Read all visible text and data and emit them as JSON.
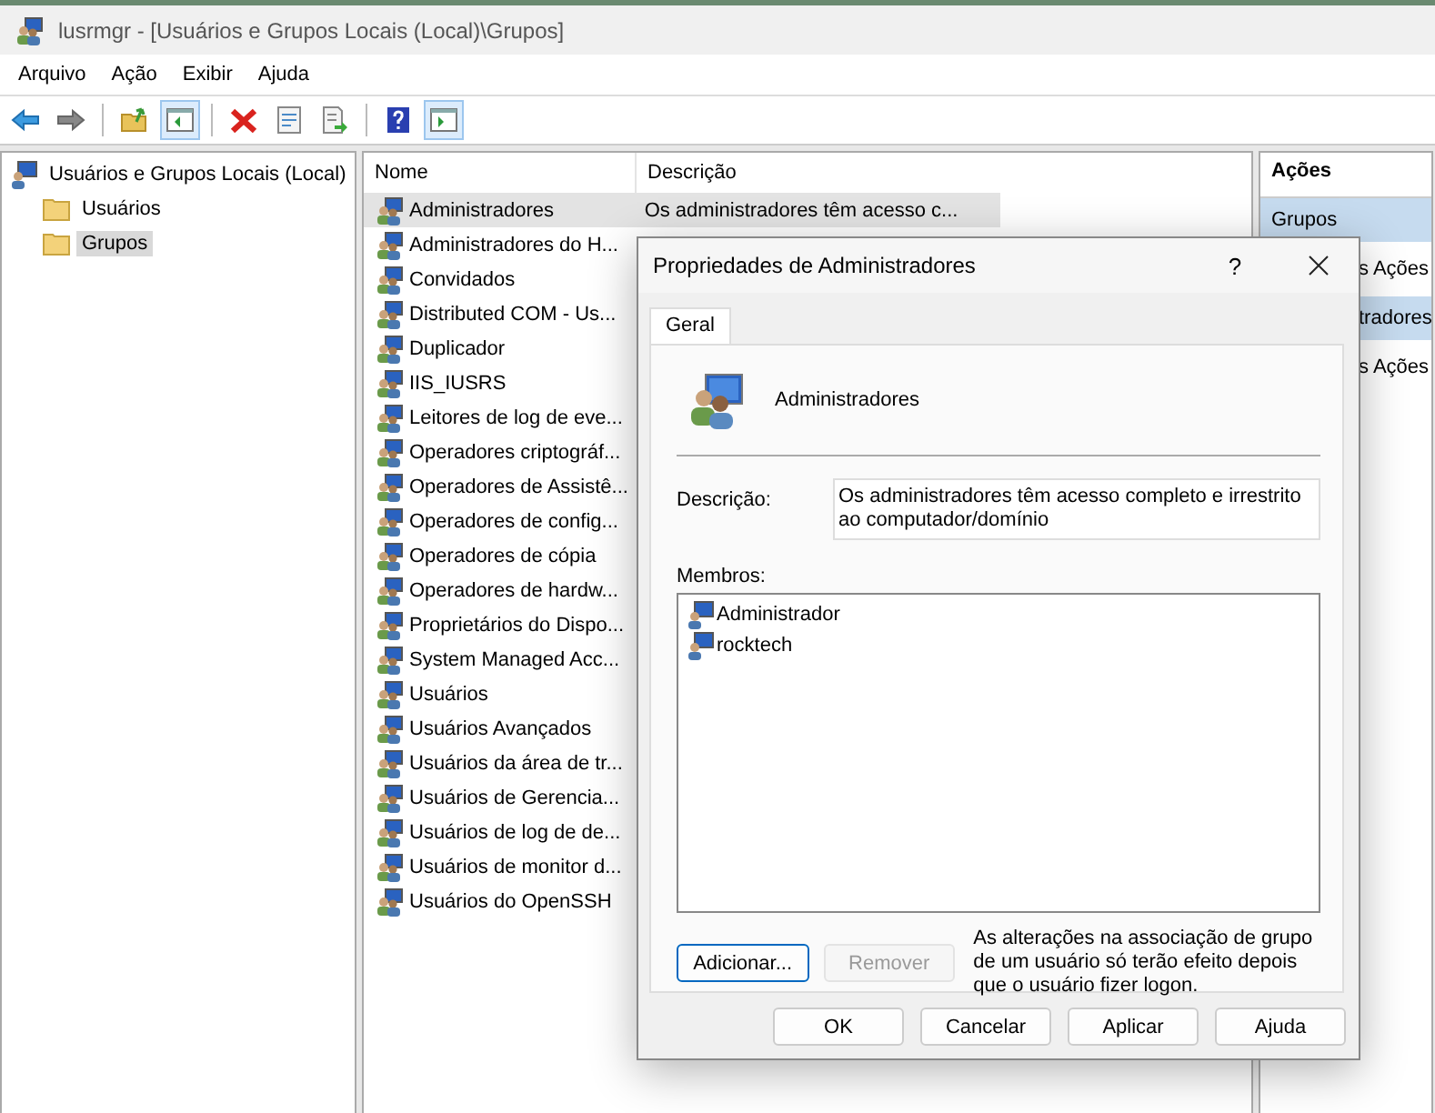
{
  "window": {
    "title": "lusrmgr - [Usuários e Grupos Locais (Local)\\Grupos]"
  },
  "menu": [
    "Arquivo",
    "Ação",
    "Exibir",
    "Ajuda"
  ],
  "toolbar": [
    [
      {
        "kind": "back",
        "on": false
      },
      {
        "kind": "forward",
        "on": false
      }
    ],
    [
      {
        "kind": "up",
        "on": false
      },
      {
        "kind": "tree",
        "on": true
      }
    ],
    [
      {
        "kind": "delete",
        "on": false
      },
      {
        "kind": "properties",
        "on": false
      },
      {
        "kind": "export",
        "on": false
      }
    ],
    [
      {
        "kind": "help",
        "on": false
      },
      {
        "kind": "pane",
        "on": true
      }
    ]
  ],
  "tree": {
    "label": "Usuários e Grupos Locais (Local)",
    "children": [
      {
        "label": "Usuários",
        "selected": false
      },
      {
        "label": "Grupos",
        "selected": true
      }
    ]
  },
  "list": {
    "columns": [
      "Nome",
      "Descrição"
    ],
    "rows": [
      {
        "name": "Administradores",
        "description": "Os administradores têm acesso c...",
        "selected": true
      },
      {
        "name": "Administradores do H...",
        "selected": false
      },
      {
        "name": "Convidados",
        "selected": false
      },
      {
        "name": "Distributed COM - Us...",
        "selected": false
      },
      {
        "name": "Duplicador",
        "selected": false
      },
      {
        "name": "IIS_IUSRS",
        "selected": false
      },
      {
        "name": "Leitores de log de eve...",
        "selected": false
      },
      {
        "name": "Operadores criptográf...",
        "selected": false
      },
      {
        "name": "Operadores de Assistê...",
        "selected": false
      },
      {
        "name": "Operadores de config...",
        "selected": false
      },
      {
        "name": "Operadores de cópia",
        "selected": false
      },
      {
        "name": "Operadores de hardw...",
        "selected": false
      },
      {
        "name": "Proprietários do Dispo...",
        "selected": false
      },
      {
        "name": "System Managed Acc...",
        "selected": false
      },
      {
        "name": "Usuários",
        "selected": false
      },
      {
        "name": "Usuários Avançados",
        "selected": false
      },
      {
        "name": "Usuários da área de tr...",
        "selected": false
      },
      {
        "name": "Usuários de Gerencia...",
        "selected": false
      },
      {
        "name": "Usuários de log de de...",
        "selected": false
      },
      {
        "name": "Usuários de monitor d...",
        "selected": false
      },
      {
        "name": "Usuários do OpenSSH",
        "selected": false
      }
    ]
  },
  "actions": {
    "title": "Ações",
    "items": [
      {
        "kind": "header",
        "label": "Grupos"
      },
      {
        "kind": "link",
        "label": "s Ações"
      },
      {
        "kind": "header",
        "label": "tradores"
      },
      {
        "kind": "link",
        "label": "s Ações"
      }
    ]
  },
  "dialog": {
    "title": "Propriedades de Administradores",
    "help": "?",
    "tabs": [
      {
        "label": "Geral",
        "selected": true
      }
    ],
    "name": "Administradores",
    "description_label": "Descrição:",
    "description": "Os administradores têm acesso completo e irrestrito ao computador/domínio",
    "members_label": "Membros:",
    "members": [
      "Administrador",
      "rocktech"
    ],
    "add": {
      "label": "Adicionar...",
      "disabled": false
    },
    "remove": {
      "label": "Remover",
      "disabled": true
    },
    "note": "As alterações na associação de grupo de um usuário só terão efeito depois que o usuário fizer logon.",
    "buttons": [
      "OK",
      "Cancelar",
      "Aplicar",
      "Ajuda"
    ]
  }
}
